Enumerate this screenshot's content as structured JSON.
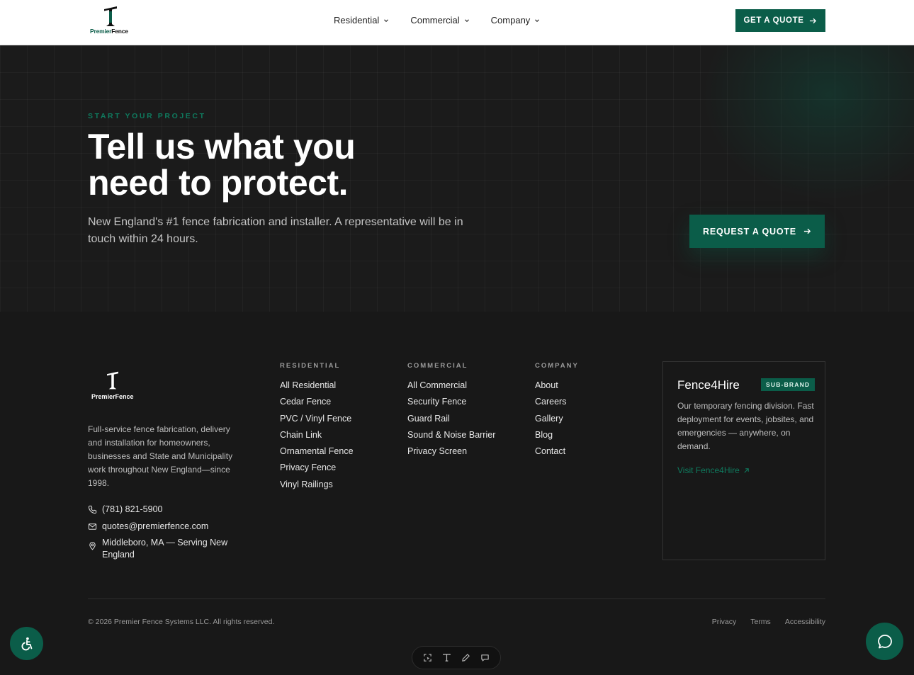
{
  "header": {
    "logo": {
      "brand_main": "Premier",
      "brand_accent": "Fence"
    },
    "nav": [
      {
        "label": "Residential",
        "icon": "chevron-down-icon"
      },
      {
        "label": "Commercial",
        "icon": "chevron-down-icon"
      },
      {
        "label": "Company",
        "icon": "chevron-down-icon"
      }
    ],
    "cta_label": "GET A QUOTE"
  },
  "hero": {
    "eyebrow": "START YOUR PROJECT",
    "title_line1": "Tell us what you",
    "title_line2": "need to protect.",
    "subtitle": "New England's #1 fence fabrication and installer. A representative will be in touch within 24 hours.",
    "cta_label": "REQUEST A QUOTE"
  },
  "footer": {
    "logo_text": "PremierFence",
    "description": "Full-service fence fabrication, delivery and installation for homeowners, businesses and State and Municipality work throughout New England—since 1998.",
    "contact": {
      "phone": "(781) 821-5900",
      "email": "quotes@premierfence.com",
      "location": "Middleboro, MA — Serving New England"
    },
    "columns": [
      {
        "heading": "RESIDENTIAL",
        "links": [
          "All Residential",
          "Cedar Fence",
          "PVC / Vinyl Fence",
          "Chain Link",
          "Ornamental Fence",
          "Privacy Fence",
          "Vinyl Railings"
        ]
      },
      {
        "heading": "COMMERCIAL",
        "links": [
          "All Commercial",
          "Security Fence",
          "Guard Rail",
          "Sound & Noise Barrier",
          "Privacy Screen"
        ]
      },
      {
        "heading": "COMPANY",
        "links": [
          "About",
          "Careers",
          "Gallery",
          "Blog",
          "Contact"
        ]
      }
    ],
    "card": {
      "title": "Fence4Hire",
      "badge": "SUB-BRAND",
      "text": "Our temporary fencing division. Fast deployment for events, jobsites, and emergencies — anywhere, on demand.",
      "link": "Visit Fence4Hire"
    },
    "copyright": "© 2026 Premier Fence Systems LLC. All rights reserved.",
    "legal": [
      "Privacy",
      "Terms",
      "Accessibility"
    ]
  },
  "colors": {
    "brand": "#0b5d49",
    "accent_text": "#0f7a5e",
    "background": "#181818"
  },
  "floating": {
    "accessibility_icon": "accessibility-icon",
    "chat_icon": "chat-bubble-icon",
    "toolbar_icons": [
      "select-icon",
      "text-icon",
      "pen-icon",
      "comment-icon"
    ]
  }
}
